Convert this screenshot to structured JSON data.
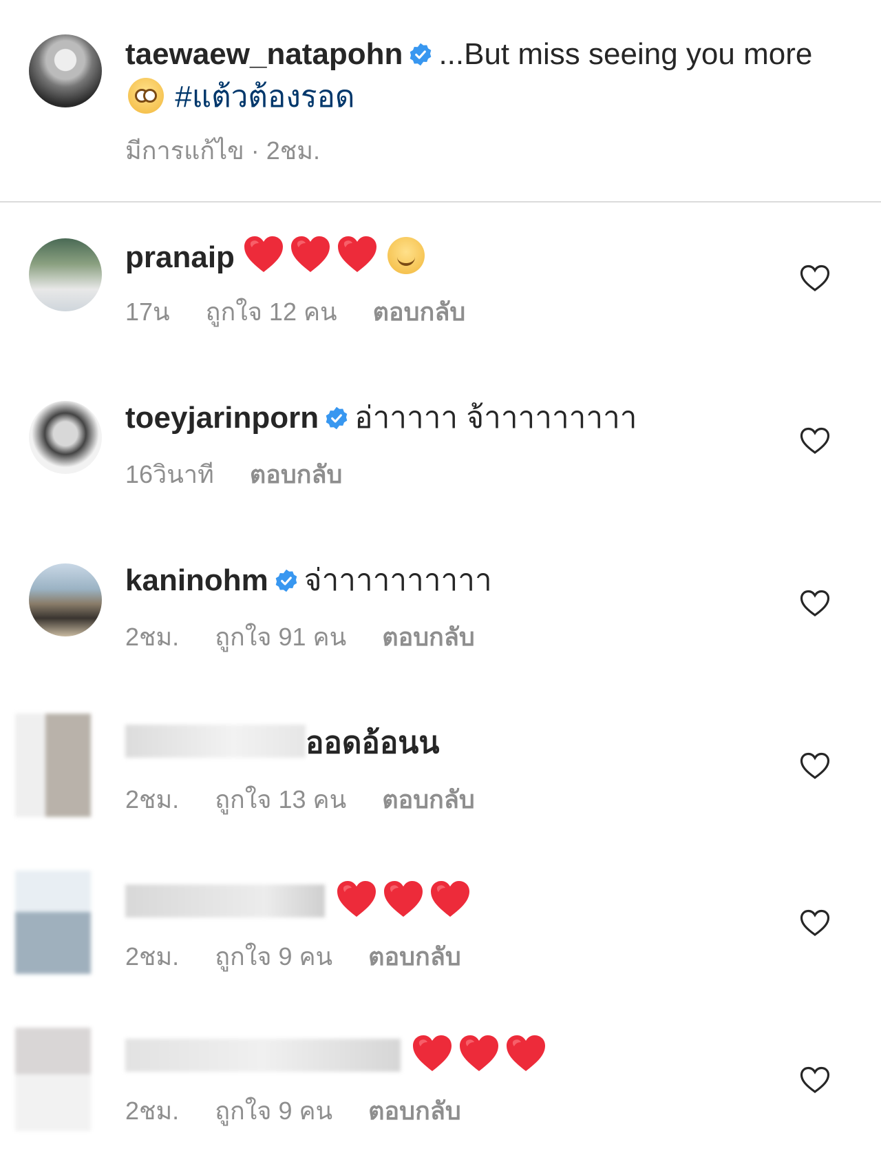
{
  "caption": {
    "username": "taewaew_natapohn",
    "text_before_emoji": "...But miss seeing you more",
    "hashtag": "#แต้วต้องรอด",
    "meta": "มีการแก้ไข · 2ชม."
  },
  "comments": [
    {
      "username": "pranaip",
      "text": "",
      "time": "17น",
      "likes": "ถูกใจ 12 คน",
      "reply": "ตอบกลับ"
    },
    {
      "username": "toeyjarinporn",
      "text": "อ่าาาาา จ้าาาาาาาาา",
      "time": "16วินาที",
      "reply": "ตอบกลับ"
    },
    {
      "username": "kaninohm",
      "text": "จ่าาาาาาาาาา",
      "time": "2ชม.",
      "likes": "ถูกใจ 91 คน",
      "reply": "ตอบกลับ"
    },
    {
      "username": "",
      "text": "ออดอ้อนน",
      "time": "2ชม.",
      "likes": "ถูกใจ 13 คน",
      "reply": "ตอบกลับ"
    },
    {
      "username": "",
      "text": "",
      "time": "2ชม.",
      "likes": "ถูกใจ 9 คน",
      "reply": "ตอบกลับ"
    },
    {
      "username": "",
      "text": "",
      "time": "2ชม.",
      "likes": "ถูกใจ 9 คน",
      "reply": "ตอบกลับ"
    }
  ],
  "colors": {
    "verified": "#3897f0",
    "heart": "#ed4956",
    "muted": "#8e8e8e",
    "hashtag": "#00376b"
  },
  "icons": {
    "verified": "verified-badge-icon",
    "like": "heart-outline-icon",
    "emoji_heart": "red-heart-emoji-icon"
  }
}
